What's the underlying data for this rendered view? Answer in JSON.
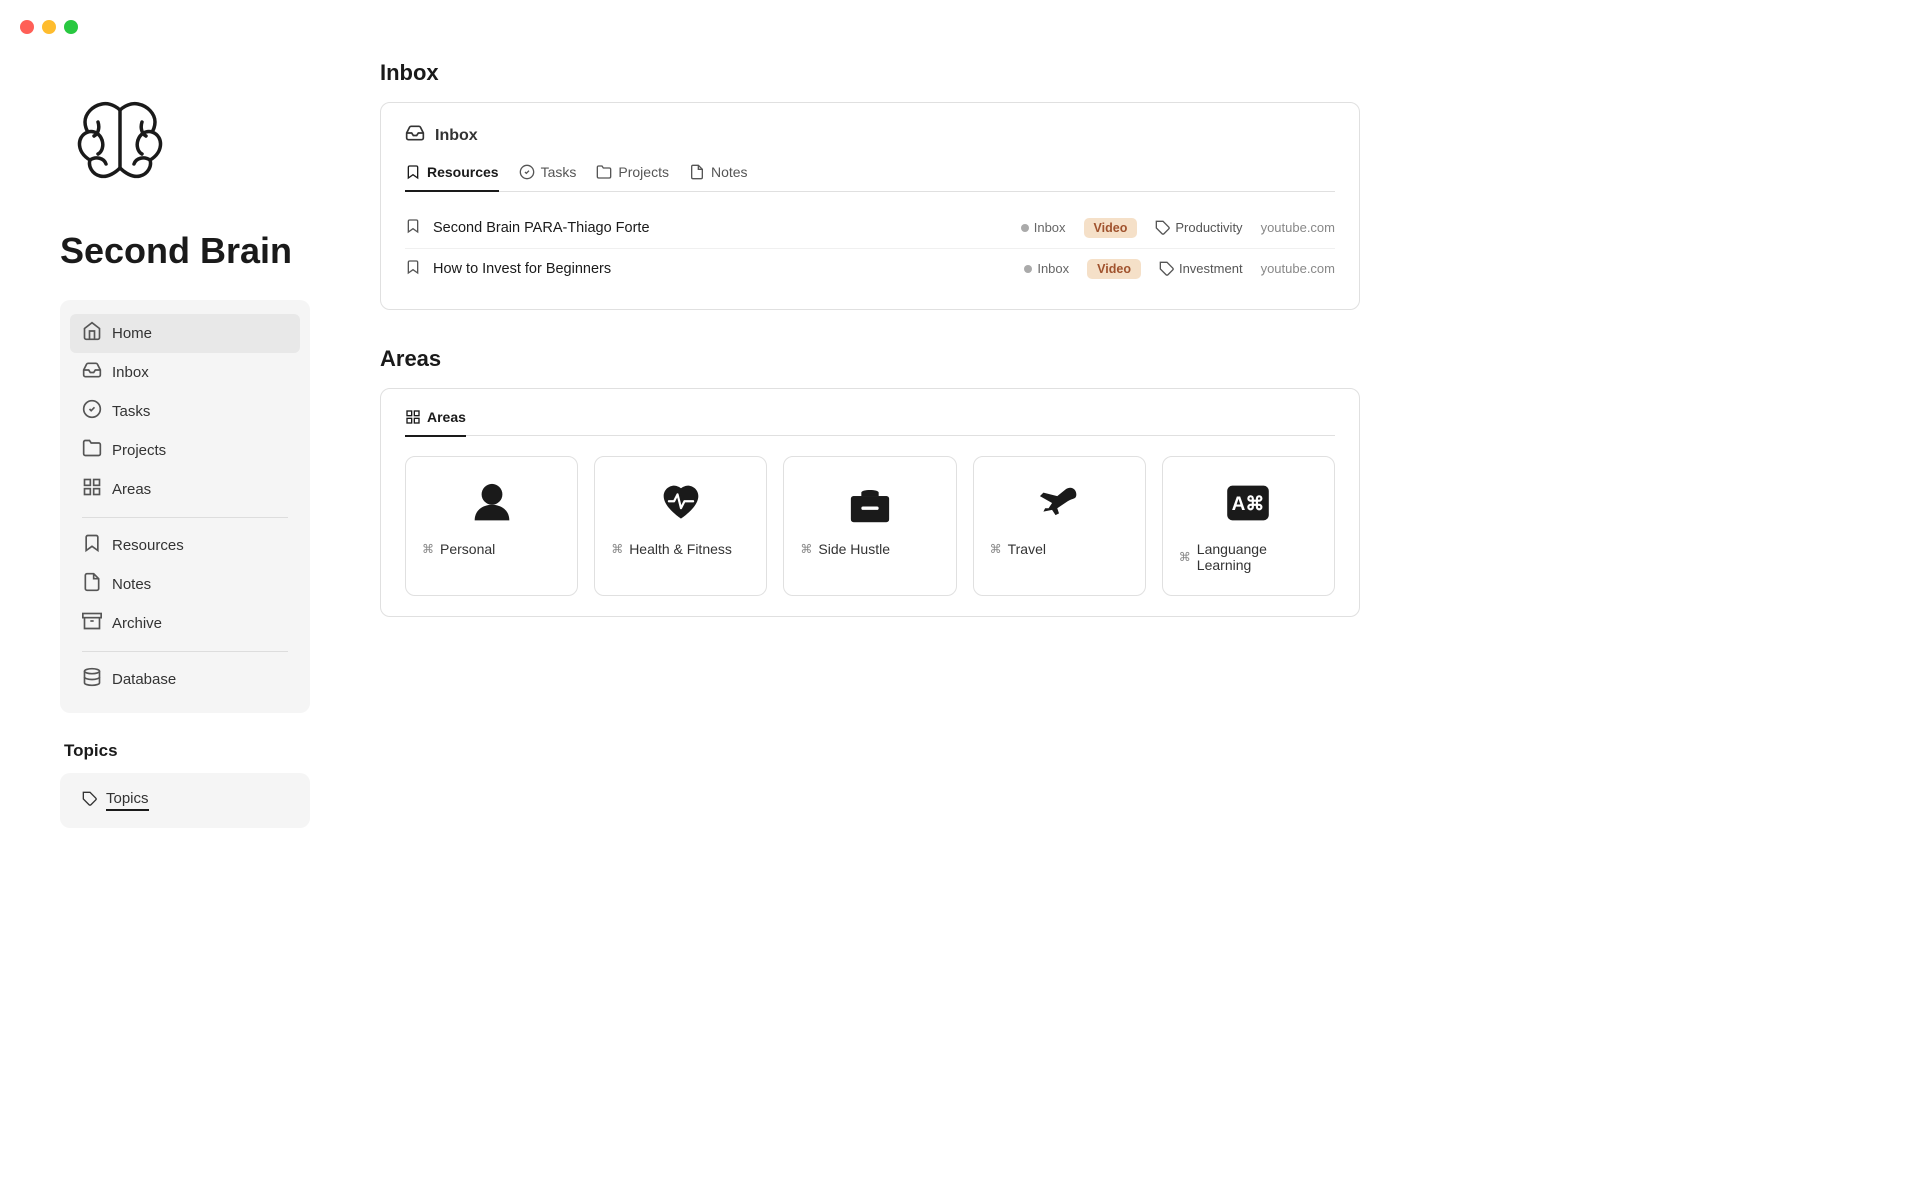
{
  "trafficLights": {
    "red": "#ff5f57",
    "yellow": "#febc2e",
    "green": "#28c840"
  },
  "pageTitle": "Second Brain",
  "sidebar": {
    "navItems": [
      {
        "id": "home",
        "label": "Home",
        "icon": "home"
      },
      {
        "id": "inbox",
        "label": "Inbox",
        "icon": "inbox"
      },
      {
        "id": "tasks",
        "label": "Tasks",
        "icon": "tasks"
      },
      {
        "id": "projects",
        "label": "Projects",
        "icon": "projects"
      },
      {
        "id": "areas",
        "label": "Areas",
        "icon": "areas"
      },
      {
        "id": "resources",
        "label": "Resources",
        "icon": "resources"
      },
      {
        "id": "notes",
        "label": "Notes",
        "icon": "notes"
      },
      {
        "id": "archive",
        "label": "Archive",
        "icon": "archive"
      },
      {
        "id": "database",
        "label": "Database",
        "icon": "database"
      }
    ],
    "topicsSection": {
      "heading": "Topics",
      "items": [
        {
          "id": "topics",
          "label": "Topics"
        }
      ]
    }
  },
  "inbox": {
    "sectionHeading": "Inbox",
    "blockHeader": "Inbox",
    "tabs": [
      {
        "id": "resources",
        "label": "Resources",
        "active": true
      },
      {
        "id": "tasks",
        "label": "Tasks",
        "active": false
      },
      {
        "id": "projects",
        "label": "Projects",
        "active": false
      },
      {
        "id": "notes",
        "label": "Notes",
        "active": false
      }
    ],
    "resources": [
      {
        "name": "Second Brain PARA-Thiago Forte",
        "status": "Inbox",
        "type": "Video",
        "topic": "Productivity",
        "source": "youtube.com"
      },
      {
        "name": "How to Invest for Beginners",
        "status": "Inbox",
        "type": "Video",
        "topic": "Investment",
        "source": "youtube.com"
      }
    ]
  },
  "areas": {
    "sectionHeading": "Areas",
    "tabs": [
      {
        "id": "areas",
        "label": "Areas",
        "active": true
      }
    ],
    "cards": [
      {
        "id": "personal",
        "label": "Personal",
        "icon": "person"
      },
      {
        "id": "health",
        "label": "Health & Fitness",
        "icon": "heart-pulse"
      },
      {
        "id": "sideHustle",
        "label": "Side Hustle",
        "icon": "briefcase"
      },
      {
        "id": "travel",
        "label": "Travel",
        "icon": "airplane"
      },
      {
        "id": "languageLearning",
        "label": "Languange Learning",
        "icon": "language"
      }
    ]
  },
  "notes": {
    "label": "Notes"
  }
}
